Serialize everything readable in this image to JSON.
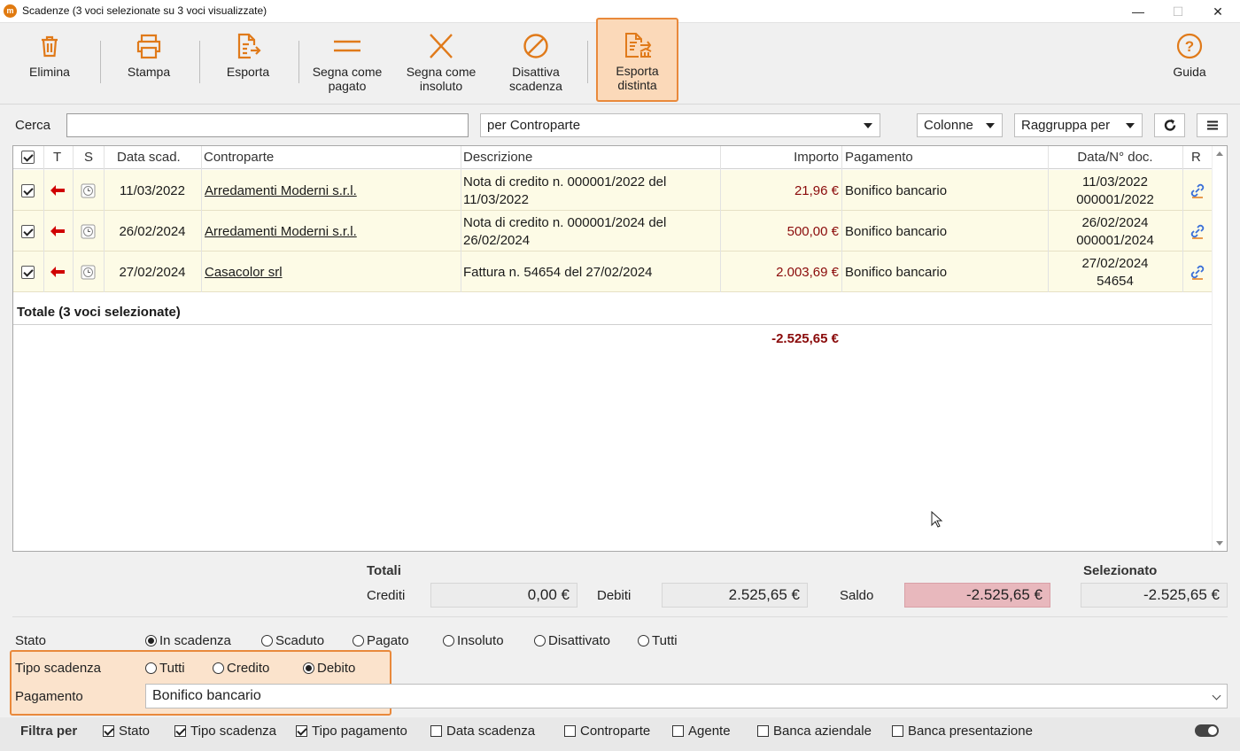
{
  "window": {
    "title": "Scadenze (3 voci selezionate su 3 voci visualizzate)",
    "app_icon": "m",
    "controls": [
      "—",
      "☐",
      "✕"
    ]
  },
  "toolbar": {
    "delete": "Elimina",
    "print": "Stampa",
    "export": "Esporta",
    "mark_paid": [
      "Segna come",
      "pagato"
    ],
    "mark_unpaid": [
      "Segna come",
      "insoluto"
    ],
    "deactivate": [
      "Disattiva",
      "scadenza"
    ],
    "export_list": [
      "Esporta",
      "distinta"
    ],
    "help": "Guida"
  },
  "search": {
    "label": "Cerca",
    "value": "",
    "mode": "per Controparte",
    "columns": "Colonne",
    "group_by": "Raggruppa per"
  },
  "table": {
    "headers": {
      "t": "T",
      "s": "S",
      "due_date": "Data scad.",
      "counterpart": "Controparte",
      "description": "Descrizione",
      "amount": "Importo",
      "payment": "Pagamento",
      "doc": "Data/N° doc.",
      "r": "R"
    },
    "rows": [
      {
        "due_date": "11/03/2022",
        "counterpart": "Arredamenti Moderni s.r.l.",
        "desc1": "Nota di credito n. 000001/2022 del",
        "desc2": "11/03/2022",
        "amount": "21,96 €",
        "payment": "Bonifico bancario",
        "doc_date": "11/03/2022",
        "doc_num": "000001/2022"
      },
      {
        "due_date": "26/02/2024",
        "counterpart": "Arredamenti Moderni s.r.l.",
        "desc1": "Nota di credito n. 000001/2024 del",
        "desc2": "26/02/2024",
        "amount": "500,00 €",
        "payment": "Bonifico bancario",
        "doc_date": "26/02/2024",
        "doc_num": "000001/2024"
      },
      {
        "due_date": "27/02/2024",
        "counterpart": "Casacolor srl",
        "desc1": "Fattura n. 54654 del 27/02/2024",
        "desc2": "",
        "amount": "2.003,69 €",
        "payment": "Bonifico bancario",
        "doc_date": "27/02/2024",
        "doc_num": "54654"
      }
    ],
    "total_label": "Totale (3 voci selezionate)",
    "total_amount": "-2.525,65 €"
  },
  "totals": {
    "title": "Totali",
    "credits_label": "Crediti",
    "credits": "0,00 €",
    "debits_label": "Debiti",
    "debits": "2.525,65 €",
    "balance_label": "Saldo",
    "balance": "-2.525,65 €",
    "selected_label": "Selezionato",
    "selected": "-2.525,65 €"
  },
  "filters": {
    "status_label": "Stato",
    "status_options": [
      "In scadenza",
      "Scaduto",
      "Pagato",
      "Insoluto",
      "Disattivato",
      "Tutti"
    ],
    "status_selected": "In scadenza",
    "type_label": "Tipo scadenza",
    "type_options": [
      "Tutti",
      "Credito",
      "Debito"
    ],
    "type_selected": "Debito",
    "payment_label": "Pagamento",
    "payment_value": "Bonifico bancario",
    "filter_by_label": "Filtra per",
    "filter_by": [
      {
        "label": "Stato",
        "checked": true
      },
      {
        "label": "Tipo scadenza",
        "checked": true
      },
      {
        "label": "Tipo pagamento",
        "checked": true
      },
      {
        "label": "Data scadenza",
        "checked": false
      },
      {
        "label": "Controparte",
        "checked": false
      },
      {
        "label": "Agente",
        "checked": false
      },
      {
        "label": "Banca aziendale",
        "checked": false
      },
      {
        "label": "Banca presentazione",
        "checked": false
      }
    ]
  },
  "colors": {
    "accent": "#e9893b",
    "amount": "#8a0a0a",
    "row_bg": "#fdfbe6",
    "negative_bg": "#e8b8bd",
    "arrow": "#d00000"
  }
}
